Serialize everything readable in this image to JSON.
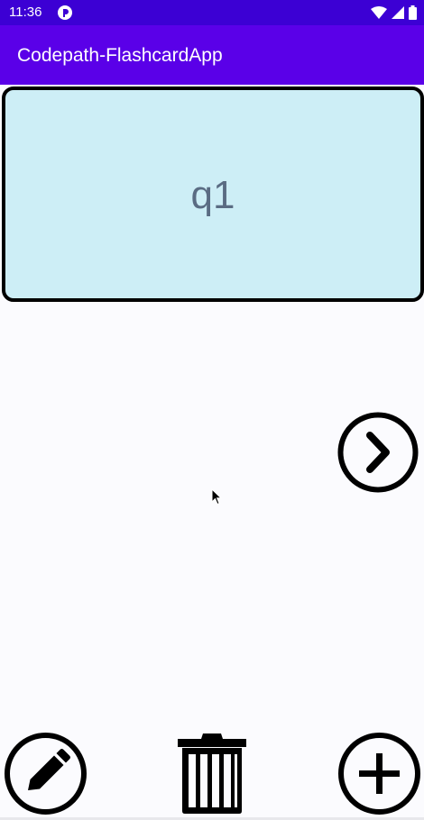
{
  "status_bar": {
    "time": "11:36"
  },
  "app_bar": {
    "title": "Codepath-FlashcardApp"
  },
  "flashcard": {
    "question": "q1"
  },
  "colors": {
    "status_bar": "#3c00d4",
    "app_bar": "#5a00e8",
    "card_background": "#cdeef6",
    "card_text": "#5a6c83"
  },
  "icons": {
    "next": "chevron-right-circle-icon",
    "edit": "pencil-circle-icon",
    "delete": "trash-icon",
    "add": "plus-circle-icon"
  }
}
